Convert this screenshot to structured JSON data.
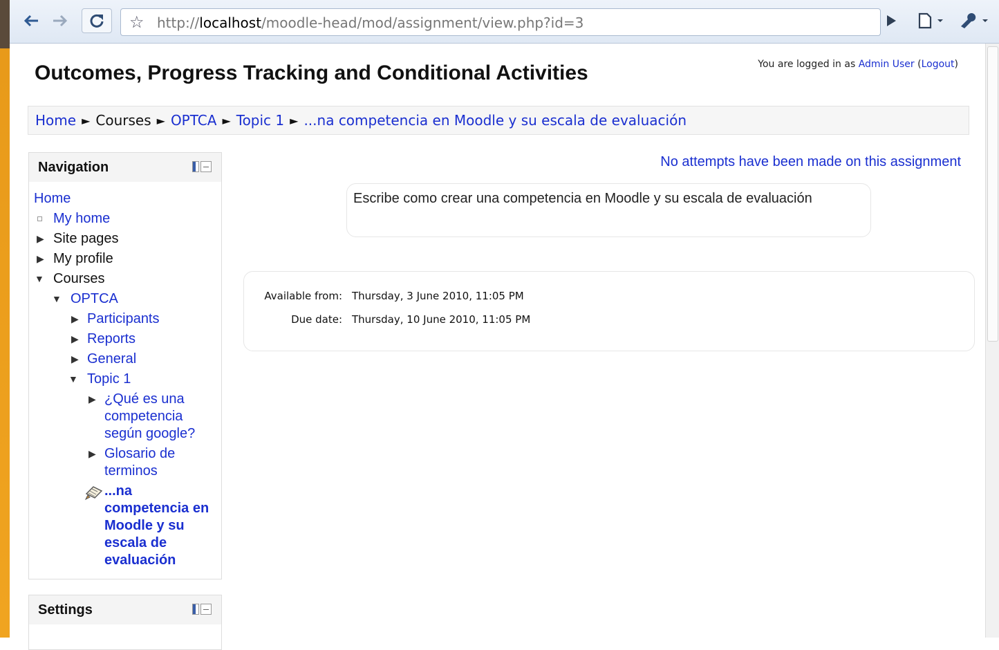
{
  "browser": {
    "url_scheme": "http://",
    "url_host": "localhost",
    "url_path": "/moodle-head/mod/assignment/view.php?id=3"
  },
  "header": {
    "title": "Outcomes, Progress Tracking and Conditional Activities",
    "login_prefix": "You are logged in as ",
    "login_user": "Admin User",
    "logout_open": " (",
    "logout_label": "Logout",
    "logout_close": ")"
  },
  "breadcrumb": {
    "items": [
      "Home",
      "Courses",
      "OPTCA",
      "Topic 1",
      "...na competencia en Moodle y su escala de evaluación"
    ],
    "separator": "►"
  },
  "navigation": {
    "title": "Navigation",
    "home": "Home",
    "my_home": "My home",
    "site_pages": "Site pages",
    "my_profile": "My profile",
    "courses": "Courses",
    "optca": "OPTCA",
    "participants": "Participants",
    "reports": "Reports",
    "general": "General",
    "topic1": "Topic 1",
    "que_es_1": "¿Qué es una",
    "que_es_2": "competencia",
    "que_es_3": "según google?",
    "glosario_1": "Glosario de",
    "glosario_2": "terminos",
    "current_1": "...na",
    "current_2": "competencia en",
    "current_3": "Moodle y su",
    "current_4": "escala de",
    "current_5": "evaluación"
  },
  "settings": {
    "title": "Settings"
  },
  "main": {
    "attempts_link": "No attempts have been made on this assignment",
    "intro": "Escribe como crear una competencia en Moodle y su escala de evaluación",
    "available_label": "Available from:",
    "available_value": "Thursday, 3 June 2010, 11:05 PM",
    "due_label": "Due date:",
    "due_value": "Thursday, 10 June 2010, 11:05 PM"
  }
}
